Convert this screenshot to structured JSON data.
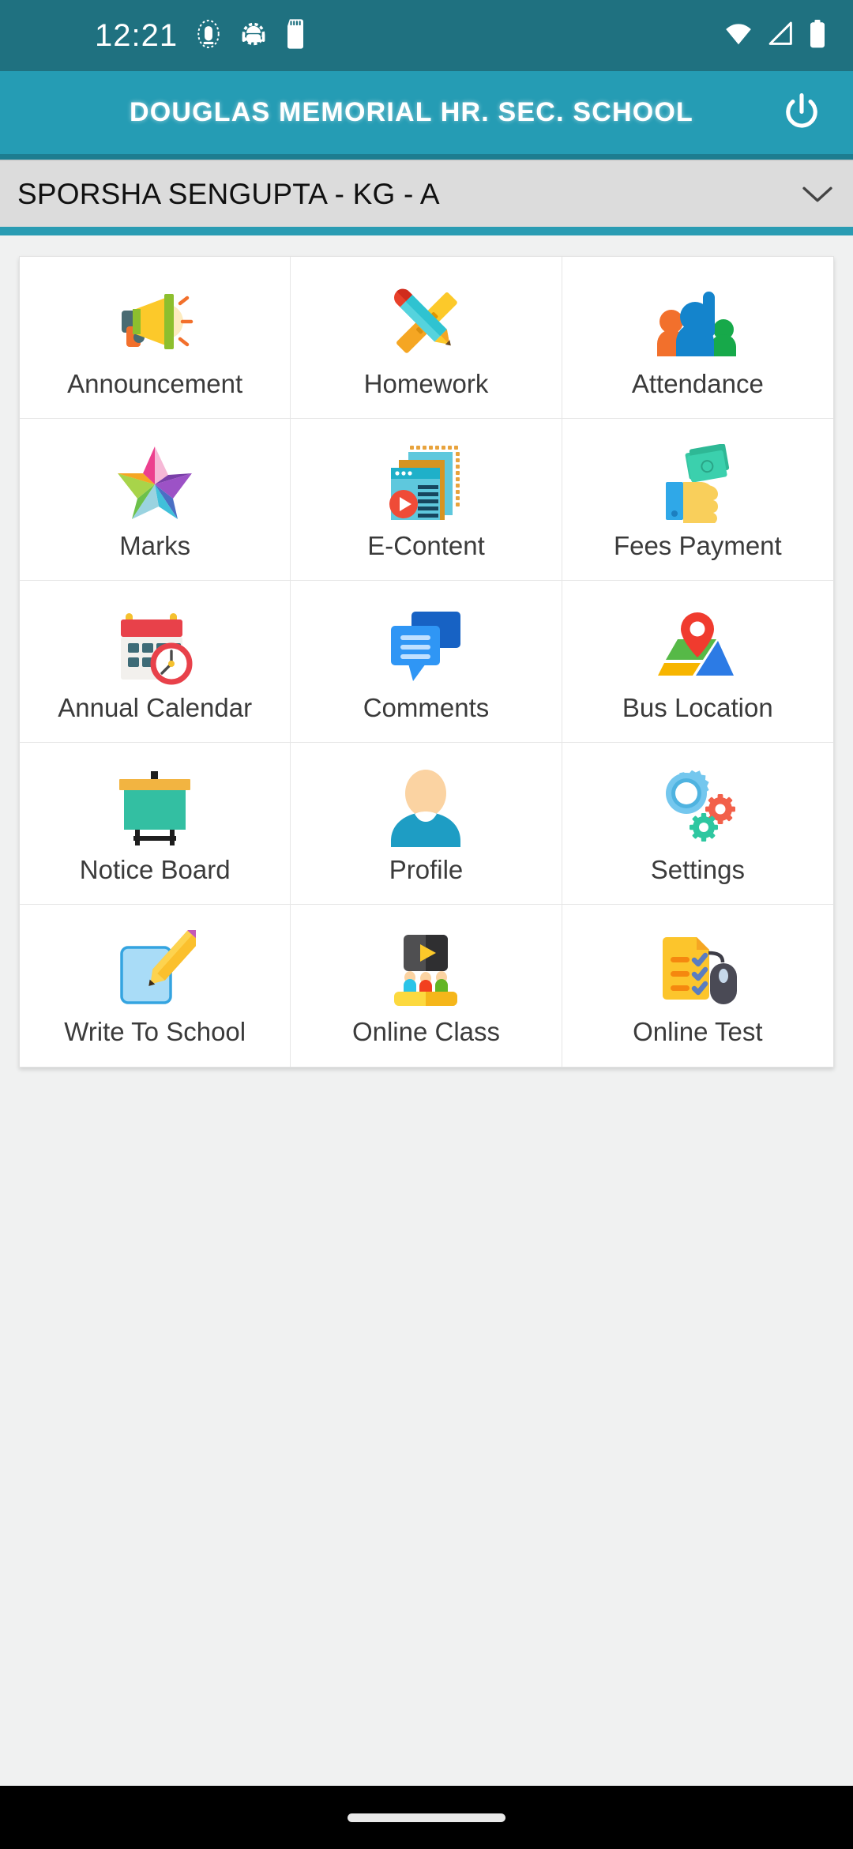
{
  "status_bar": {
    "time": "12:21",
    "icons": [
      "vibrate-icon",
      "android-debug-icon",
      "sd-card-icon"
    ],
    "right_icons": [
      "wifi-icon",
      "signal-icon",
      "battery-icon"
    ]
  },
  "app_bar": {
    "title": "DOUGLAS MEMORIAL HR. SEC. SCHOOL",
    "power_label": "power-icon",
    "background": "#259cb4"
  },
  "selector": {
    "value": "SPORSHA SENGUPTA - KG - A",
    "chevron": "chevron-down-icon",
    "background": "#dcdcdc",
    "underline_color": "#2a9cb3"
  },
  "grid": {
    "tiles": [
      {
        "label": "Announcement",
        "icon": "megaphone-icon"
      },
      {
        "label": "Homework",
        "icon": "pencil-ruler-icon"
      },
      {
        "label": "Attendance",
        "icon": "people-raised-hand-icon"
      },
      {
        "label": "Marks",
        "icon": "colorful-star-icon"
      },
      {
        "label": "E-Content",
        "icon": "media-documents-icon"
      },
      {
        "label": "Fees Payment",
        "icon": "hand-cash-icon"
      },
      {
        "label": "Annual Calendar",
        "icon": "calendar-clock-icon"
      },
      {
        "label": "Comments",
        "icon": "chat-bubbles-icon"
      },
      {
        "label": "Bus Location",
        "icon": "map-pin-icon"
      },
      {
        "label": "Notice Board",
        "icon": "notice-board-icon"
      },
      {
        "label": "Profile",
        "icon": "user-avatar-icon"
      },
      {
        "label": "Settings",
        "icon": "gears-icon"
      },
      {
        "label": "Write To School",
        "icon": "note-pencil-icon"
      },
      {
        "label": "Online Class",
        "icon": "classroom-screen-icon"
      },
      {
        "label": "Online Test",
        "icon": "checklist-mouse-icon"
      }
    ]
  },
  "nav_bar": {
    "handle": "home-gesture-pill"
  }
}
